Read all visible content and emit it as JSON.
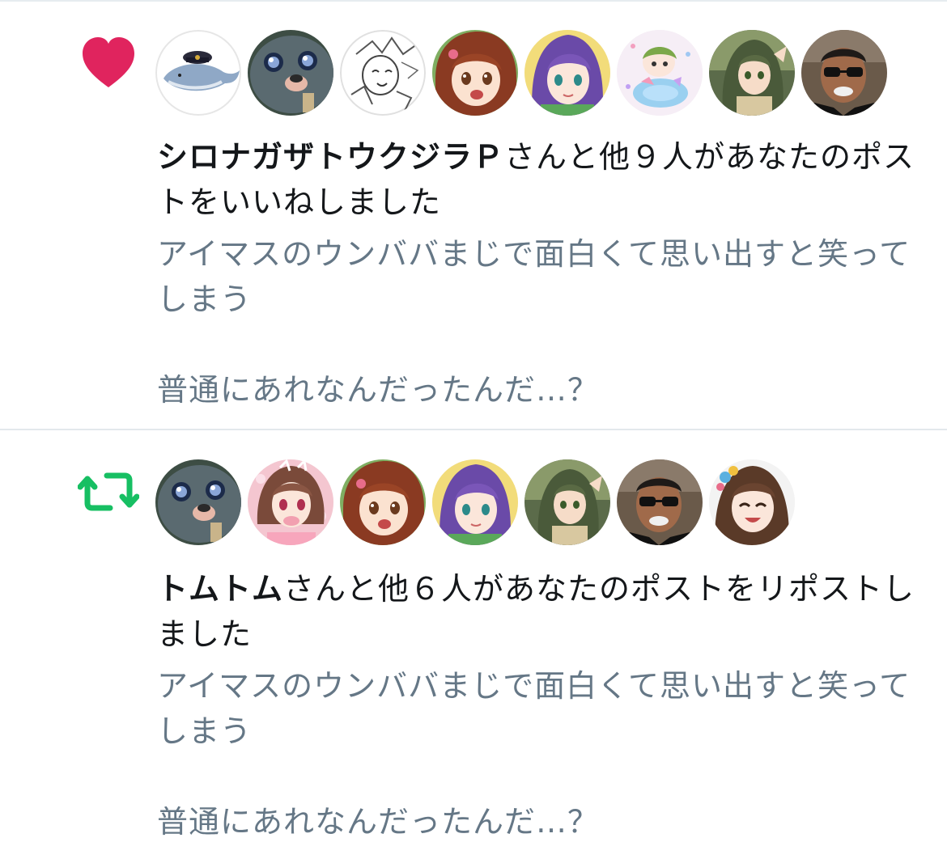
{
  "colors": {
    "like": "#e0245e",
    "retweet": "#17bf63",
    "text_primary": "#14171a",
    "text_secondary": "#657786",
    "divider": "#e3e8ec"
  },
  "notifications": [
    {
      "type": "like",
      "icon": "heart-icon",
      "avatars": [
        {
          "name": "whale-captain-avatar"
        },
        {
          "name": "seal-avatar"
        },
        {
          "name": "sketch-character-avatar"
        },
        {
          "name": "brown-hair-girl-avatar"
        },
        {
          "name": "purple-hair-girl-avatar"
        },
        {
          "name": "pastel-sticker-avatar"
        },
        {
          "name": "green-hair-girl-avatar"
        },
        {
          "name": "sunglasses-man-avatar"
        }
      ],
      "actor": "シロナガザトウクジラＰ",
      "action_text": "さんと他９人があなたのポストをいいねしました",
      "post_line1": "アイマスのウンババまじで面白くて思い出すと笑ってしまう",
      "post_line2": "普通にあれなんだったんだ…？"
    },
    {
      "type": "retweet",
      "icon": "retweet-icon",
      "avatars": [
        {
          "name": "seal-avatar"
        },
        {
          "name": "pink-kimono-girl-avatar"
        },
        {
          "name": "brown-hair-girl-avatar"
        },
        {
          "name": "purple-hair-girl-avatar"
        },
        {
          "name": "green-hair-girl-avatar"
        },
        {
          "name": "sunglasses-man-avatar"
        },
        {
          "name": "smiling-girl-avatar"
        }
      ],
      "actor": "トムトム",
      "action_text": "さんと他６人があなたのポストをリポストしました",
      "post_line1": "アイマスのウンババまじで面白くて思い出すと笑ってしまう",
      "post_line2": "普通にあれなんだったんだ…？"
    }
  ]
}
